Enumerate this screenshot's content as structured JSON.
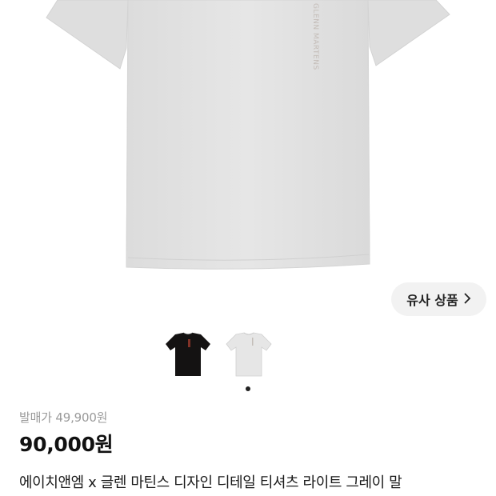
{
  "product": {
    "original_price_label": "발매가",
    "original_price_value": "49,900원",
    "price": "90,000원",
    "title": "에이치앤엠 x 글렌 마틴스 디자인 디테일 티셔츠 라이트 그레이 말",
    "hero_image": "gray-tshirt-image",
    "hero_print_text": "GLENN MARTENS"
  },
  "similar_button": {
    "label": "유사 상품",
    "icon": "chevron-right-icon"
  },
  "gallery": {
    "thumbnails": [
      {
        "name": "black-tshirt-thumbnail",
        "color": "#141212"
      },
      {
        "name": "gray-tshirt-thumbnail",
        "color": "#e6e6e6"
      }
    ],
    "active_index": 1
  },
  "colors": {
    "shirt_gray": "#e2e2e2",
    "shirt_black": "#141212",
    "button_bg": "#f2f2f2",
    "muted_text": "#9a9a9a"
  }
}
